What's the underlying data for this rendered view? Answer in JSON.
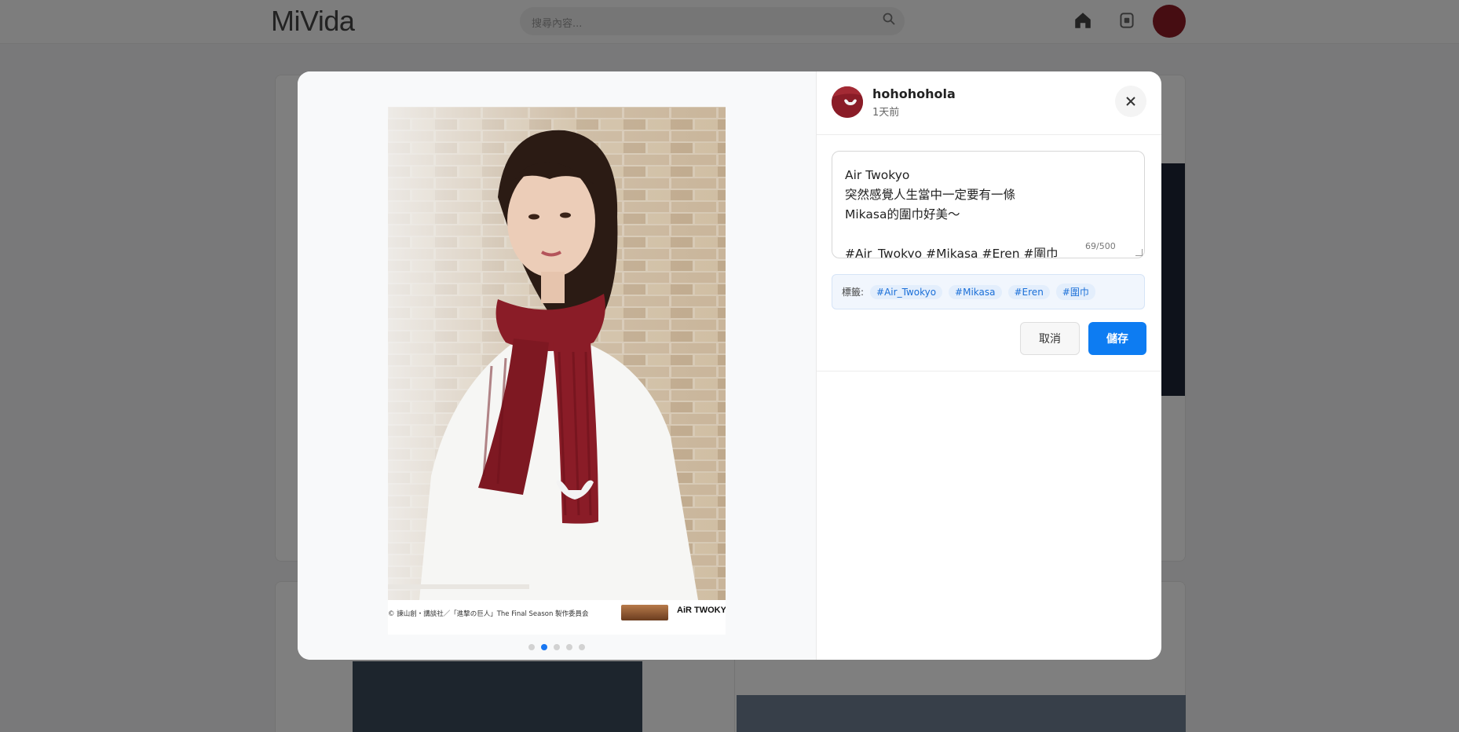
{
  "app": {
    "logo": "MiVida",
    "search_placeholder": "搜尋內容...",
    "icons": [
      "search-icon",
      "home-icon",
      "bell-icon"
    ]
  },
  "modal": {
    "author": {
      "name": "hohohohola",
      "time": "1天前"
    },
    "photo_credit": "© 諫山創・講談社／「進撃の巨人」The Final Season 製作委員会",
    "brand_logo": "AiR TWOKYO",
    "carousel": {
      "total": 5,
      "active_index": 2
    },
    "editor": {
      "text": "Air Twokyo\n突然感覺人生當中一定要有一條\nMikasa的圍巾好美～\n\n#Air_Twokyo #Mikasa #Eren #圍巾",
      "counter": "69/500"
    },
    "tags": {
      "label": "標籤:",
      "items": [
        "#Air_Twokyo",
        "#Mikasa",
        "#Eren",
        "#圍巾"
      ]
    },
    "buttons": {
      "cancel": "取消",
      "save": "儲存"
    }
  },
  "colors": {
    "accent": "#0d7cf2",
    "scarf": "#8a1c27"
  }
}
